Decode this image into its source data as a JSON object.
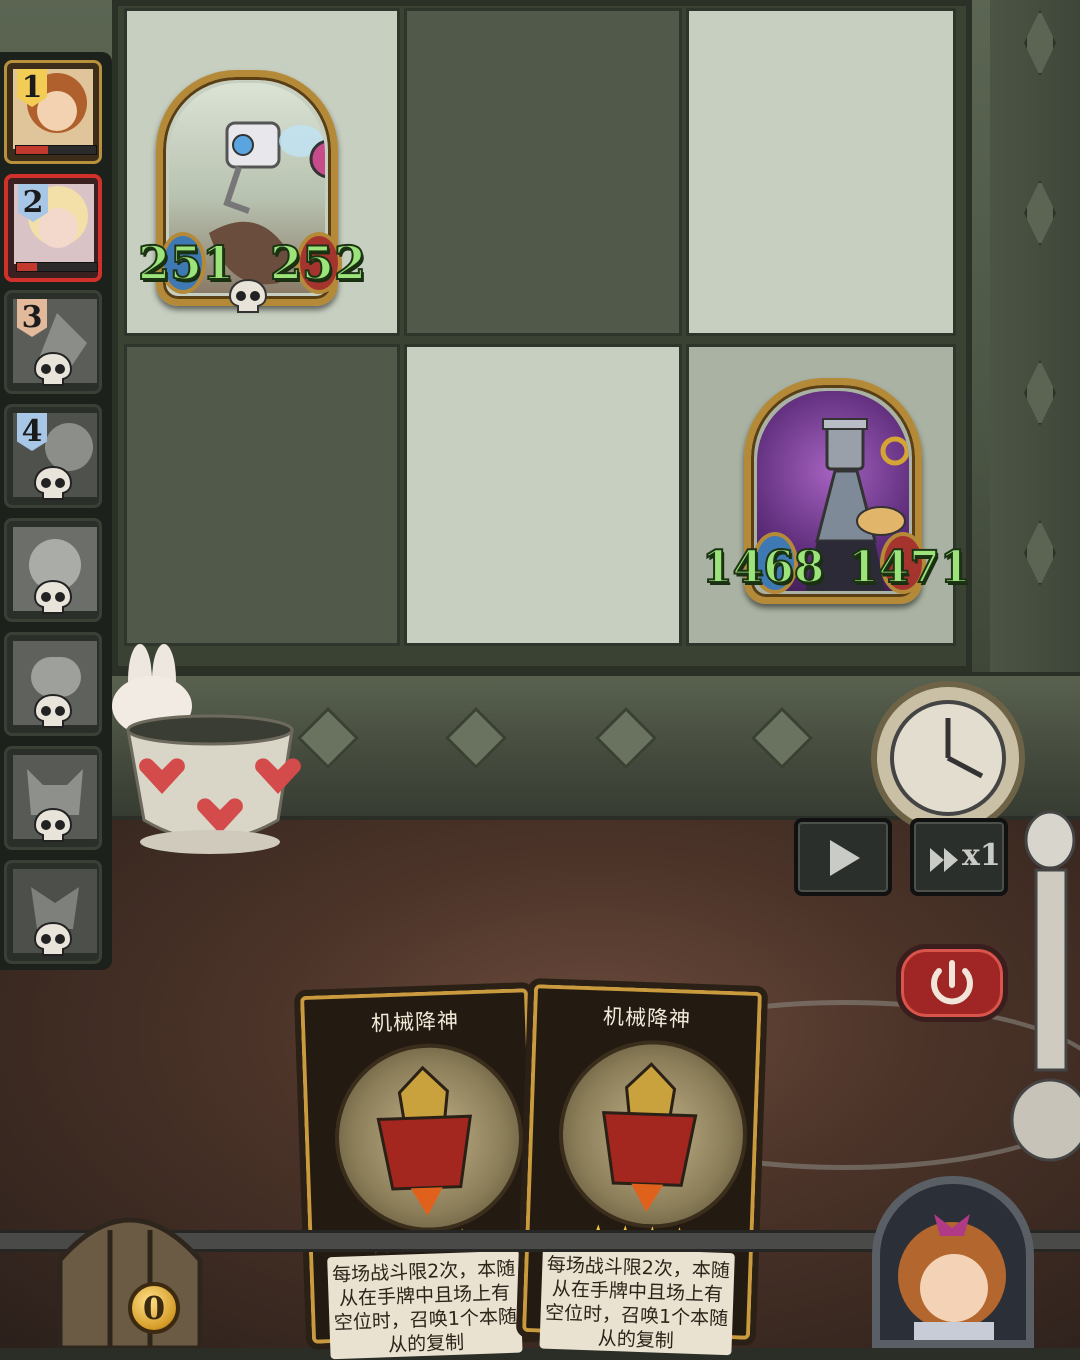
{
  "board": {
    "ally_unit": {
      "name": "mechanical-fly-bot",
      "attack": "251",
      "health": "252"
    },
    "enemy_unit": {
      "name": "clockwork-painter-bot",
      "attack": "1468",
      "health": "1471"
    }
  },
  "roster": {
    "slots": [
      {
        "number": "1",
        "state": "active",
        "hp_fraction": 0.4
      },
      {
        "number": "2",
        "state": "selected",
        "hp_fraction": 0.25
      },
      {
        "number": "3",
        "state": "defeated"
      },
      {
        "number": "4",
        "state": "defeated"
      },
      {
        "number": "",
        "state": "defeated"
      },
      {
        "number": "",
        "state": "defeated"
      },
      {
        "number": "",
        "state": "defeated"
      },
      {
        "number": "",
        "state": "defeated"
      }
    ]
  },
  "controls": {
    "play_icon": "play-icon",
    "speed_label": "x1",
    "power_icon": "power-icon"
  },
  "hand": {
    "cards": [
      {
        "title": "机械降神",
        "stars": 4,
        "description": "每场战斗限2次，本随从在手牌中且场上有空位时，召唤1个本随从的复制"
      },
      {
        "title": "机械降神",
        "stars": 4,
        "description": "每场战斗限2次，本随从在手牌中且场上有空位时，召唤1个本随从的复制"
      }
    ]
  },
  "player": {
    "coins": "0"
  },
  "colors": {
    "stat_green": "#9be37a",
    "frame_gold": "#b48a38",
    "selected_red": "#d2302b",
    "power_red": "#a02626"
  }
}
